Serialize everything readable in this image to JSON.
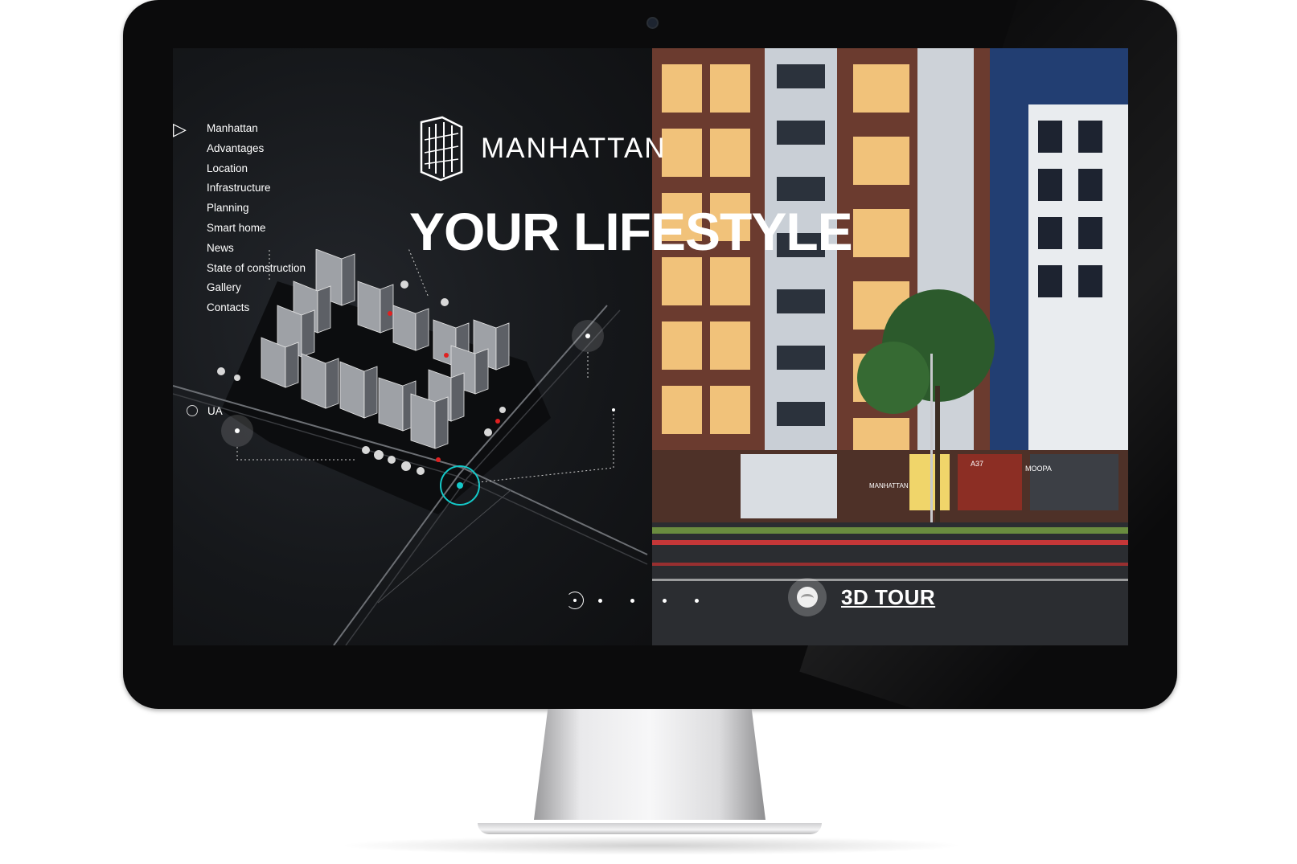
{
  "nav": {
    "items": [
      "Manhattan",
      "Advantages",
      "Location",
      "Infrastructure",
      "Planning",
      "Smart home",
      "News",
      "State of construction",
      "Gallery",
      "Contacts"
    ],
    "language": "UA"
  },
  "logo": {
    "text": "MANHATTAN"
  },
  "hero": {
    "headline": "YOUR LIFESTYLE"
  },
  "pagination": {
    "total": 5,
    "active": 1
  },
  "tour": {
    "label": "3D TOUR"
  },
  "building": {
    "sign_manhattan": "MANHATTAN",
    "sign_shop1": "A37",
    "sign_shop2": "MOOPA"
  },
  "colors": {
    "accent": "#14c9c9",
    "marker": "#e02020",
    "screen_bg": "#17191c"
  }
}
